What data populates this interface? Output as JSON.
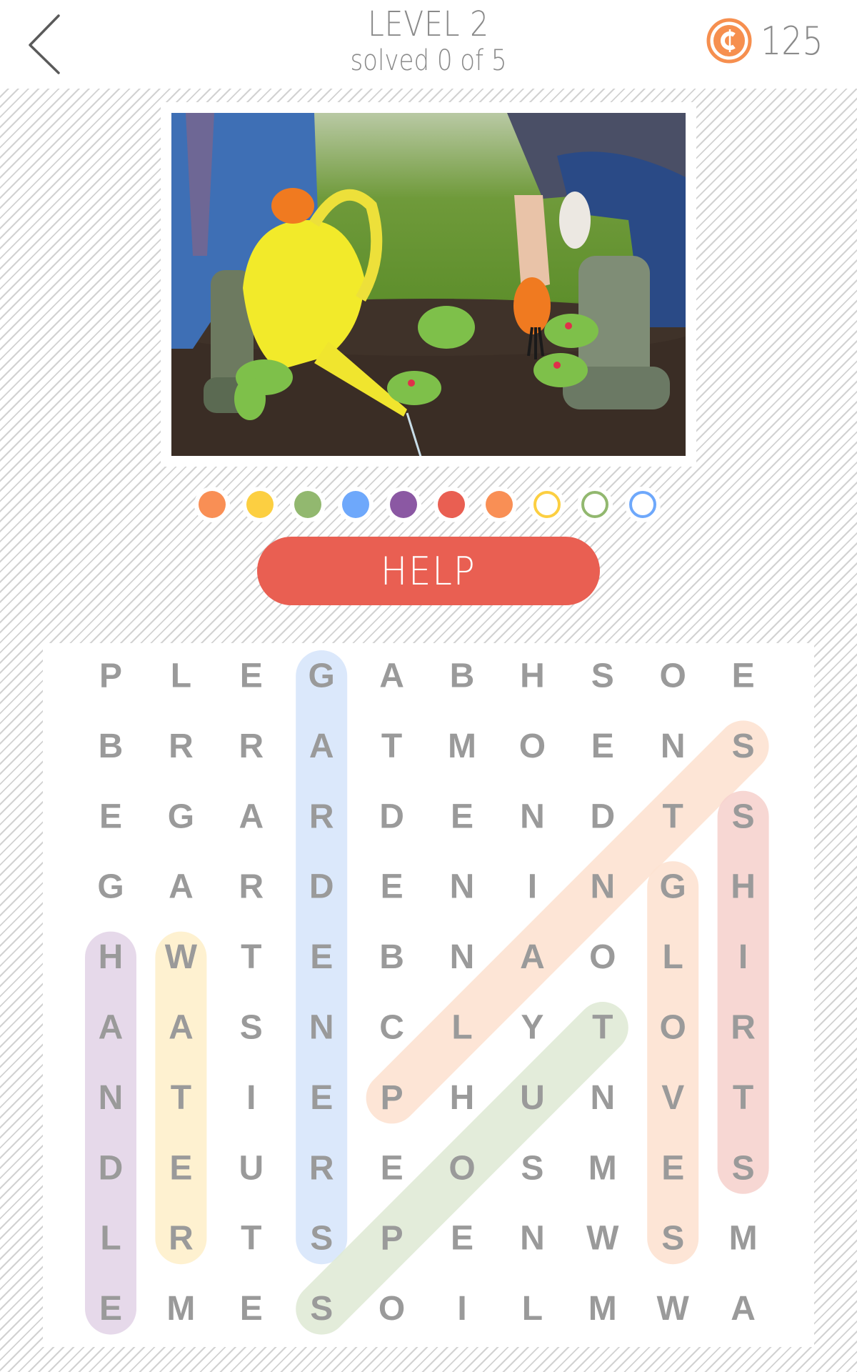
{
  "header": {
    "back_label": "Back",
    "level_title": "LEVEL 2",
    "progress_text": "solved 0 of 5",
    "solved": 0,
    "total": 5,
    "coins": "125",
    "coin_color": "#f68f4f"
  },
  "puzzle_image": {
    "description": "Two gardeners planting seedlings; one pours water from a yellow watering can, the other digs with a hand fork wearing orange gloves and rubber boots"
  },
  "letter_slots": [
    {
      "color": "#f98f55",
      "filled": true
    },
    {
      "color": "#fccf41",
      "filled": true
    },
    {
      "color": "#92b86f",
      "filled": true
    },
    {
      "color": "#6ea8fb",
      "filled": true
    },
    {
      "color": "#8b58a3",
      "filled": true
    },
    {
      "color": "#e95f52",
      "filled": true
    },
    {
      "color": "#f98f55",
      "filled": true
    },
    {
      "color": "#fccf41",
      "filled": false
    },
    {
      "color": "#92b86f",
      "filled": false
    },
    {
      "color": "#6ea8fb",
      "filled": false
    }
  ],
  "help_button": {
    "label": "HELP",
    "color": "#e95f52"
  },
  "grid": {
    "rows": [
      [
        "P",
        "L",
        "E",
        "G",
        "A",
        "B",
        "H",
        "S",
        "O",
        "E"
      ],
      [
        "B",
        "R",
        "R",
        "A",
        "T",
        "M",
        "O",
        "E",
        "N",
        "S"
      ],
      [
        "E",
        "G",
        "A",
        "R",
        "D",
        "E",
        "N",
        "D",
        "T",
        "S"
      ],
      [
        "G",
        "A",
        "R",
        "D",
        "E",
        "N",
        "I",
        "N",
        "G",
        "H"
      ],
      [
        "H",
        "W",
        "T",
        "E",
        "B",
        "N",
        "A",
        "O",
        "L",
        "I"
      ],
      [
        "A",
        "A",
        "S",
        "N",
        "C",
        "L",
        "Y",
        "T",
        "O",
        "R"
      ],
      [
        "N",
        "T",
        "I",
        "E",
        "P",
        "H",
        "U",
        "N",
        "V",
        "T"
      ],
      [
        "D",
        "E",
        "U",
        "R",
        "E",
        "O",
        "S",
        "M",
        "E",
        "S"
      ],
      [
        "L",
        "R",
        "T",
        "S",
        "P",
        "E",
        "N",
        "W",
        "S",
        "M"
      ],
      [
        "E",
        "M",
        "E",
        "S",
        "O",
        "I",
        "L",
        "M",
        "W",
        "A"
      ]
    ],
    "highlights": [
      {
        "word": "GARDENERS",
        "from": [
          0,
          3
        ],
        "to": [
          8,
          3
        ],
        "color": "#d8e6fb"
      },
      {
        "word": "PLANTS",
        "from": [
          1,
          9
        ],
        "to": [
          6,
          4
        ],
        "color": "#fde3d2"
      },
      {
        "word": "SHIRTS",
        "from": [
          2,
          9
        ],
        "to": [
          7,
          9
        ],
        "color": "#f7d3cf"
      },
      {
        "word": "GLOVES",
        "from": [
          3,
          8
        ],
        "to": [
          8,
          8
        ],
        "color": "#fde3d2"
      },
      {
        "word": "HANDLE",
        "from": [
          4,
          0
        ],
        "to": [
          9,
          0
        ],
        "color": "#e4d5e8"
      },
      {
        "word": "WATER",
        "from": [
          4,
          1
        ],
        "to": [
          8,
          1
        ],
        "color": "#fef0cc"
      },
      {
        "word": "SPOUT",
        "from": [
          5,
          7
        ],
        "to": [
          9,
          3
        ],
        "color": "#e0ebd6"
      }
    ]
  }
}
